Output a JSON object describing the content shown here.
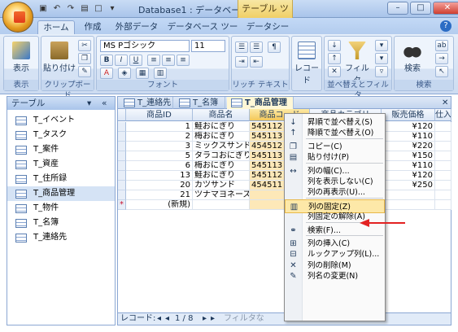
{
  "window": {
    "title": "Database1 : データベース ...",
    "context_tab": "テーブル ツール",
    "buttons": [
      "–",
      "□",
      "✕"
    ]
  },
  "qat": {
    "icons": [
      "save-icon",
      "undo-icon",
      "redo-icon",
      "file-icon",
      "new-icon",
      "dropdown-icon"
    ]
  },
  "ribbon": {
    "tabs": [
      "ホーム",
      "作成",
      "外部データ",
      "データベース ツール",
      "データシート"
    ],
    "active_tab": "ホーム",
    "groups": {
      "view": {
        "label": "表示",
        "button": "表示"
      },
      "clipboard": {
        "label": "クリップボード",
        "paste": "貼り付け"
      },
      "font": {
        "label": "フォント",
        "font_name": "MS Pゴシック",
        "font_size": "11",
        "bold": "B",
        "italic": "I",
        "underline": "U"
      },
      "richtext": {
        "label": "リッチ テキスト"
      },
      "records": {
        "button": "レコード"
      },
      "sort": {
        "label": "並べ替えとフィルタ",
        "filter": "フィルタ"
      },
      "find": {
        "label": "検索",
        "button": "検索"
      }
    }
  },
  "nav": {
    "header": "テーブル",
    "items": [
      "T_イベント",
      "T_タスク",
      "T_案件",
      "T_資産",
      "T_住所録",
      "T_商品管理",
      "T_物件",
      "T_名簿",
      "T_連絡先"
    ],
    "selected": "T_商品管理"
  },
  "doc_tabs": [
    {
      "label": "T_連絡先",
      "active": false
    },
    {
      "label": "T_名簿",
      "active": false
    },
    {
      "label": "T_商品管理",
      "active": true
    }
  ],
  "grid": {
    "headers": [
      "商品ID",
      "商品名",
      "商品コード",
      "商品カテゴリ",
      "販売価格",
      "仕入"
    ],
    "rows": [
      {
        "id": "1",
        "name": "鮭おにぎり",
        "code": "545112",
        "price": "¥120"
      },
      {
        "id": "2",
        "name": "梅おにぎり",
        "code": "545113",
        "price": "¥110"
      },
      {
        "id": "3",
        "name": "ミックスサンド",
        "code": "454512",
        "price": "¥220"
      },
      {
        "id": "5",
        "name": "タラコおにぎり",
        "code": "545113",
        "price": "¥150"
      },
      {
        "id": "6",
        "name": "梅おにぎり",
        "code": "545113",
        "price": "¥110"
      },
      {
        "id": "13",
        "name": "鮭おにぎり",
        "code": "545112",
        "price": "¥120"
      },
      {
        "id": "20",
        "name": "カツサンド",
        "code": "454511",
        "price": "¥250"
      },
      {
        "id": "21",
        "name": "ツナマヨネーズ",
        "code": "",
        "price": ""
      }
    ],
    "new_row": "(新規)",
    "new_row_marker": "*"
  },
  "record_bar": {
    "label": "レコード:",
    "position": "1 / 8",
    "filter": "フィルタな"
  },
  "context_menu": {
    "items": [
      {
        "label": "昇順で並べ替え(S)",
        "icon": "sort-asc-icon"
      },
      {
        "label": "降順で並べ替え(O)",
        "icon": "sort-desc-icon"
      },
      {
        "sep": true
      },
      {
        "label": "コピー(C)",
        "icon": "copy-icon"
      },
      {
        "label": "貼り付け(P)",
        "icon": "paste-icon"
      },
      {
        "sep": true
      },
      {
        "label": "列の幅(C)...",
        "icon": "column-width-icon"
      },
      {
        "label": "列を表示しない(C)",
        "icon": ""
      },
      {
        "label": "列の再表示(U)...",
        "icon": ""
      },
      {
        "sep": true
      },
      {
        "label": "列の固定(Z)",
        "icon": "freeze-column-icon",
        "highlight": true
      },
      {
        "label": "列固定の解除(A)",
        "icon": ""
      },
      {
        "sep": true
      },
      {
        "label": "検索(F)...",
        "icon": "binoculars-icon"
      },
      {
        "sep": true
      },
      {
        "label": "列の挿入(C)",
        "icon": "insert-column-icon"
      },
      {
        "label": "ルックアップ列(L)...",
        "icon": "lookup-column-icon"
      },
      {
        "label": "列の削除(M)",
        "icon": "delete-column-icon"
      },
      {
        "label": "列名の変更(N)",
        "icon": "rename-column-icon"
      }
    ]
  },
  "colors": {
    "accent": "#e23a1a",
    "selection": "#fde8b8",
    "ribbon": "#cddcf1"
  }
}
